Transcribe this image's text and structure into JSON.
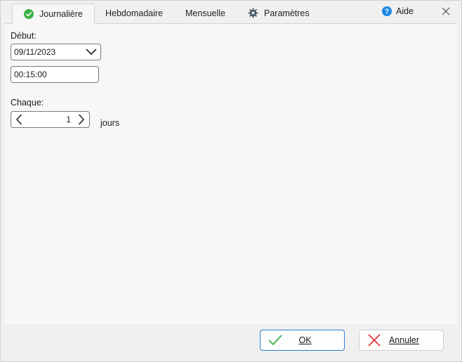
{
  "tabs": [
    {
      "label": "Journalière",
      "icon": "check-circle-icon",
      "active": true
    },
    {
      "label": "Hebdomadaire",
      "active": false
    },
    {
      "label": "Mensuelle",
      "active": false
    },
    {
      "label": "Paramètres",
      "icon": "gear-icon",
      "active": false
    }
  ],
  "help": {
    "label": "Aide",
    "icon": "help-icon"
  },
  "form": {
    "start_label": "Début:",
    "start_date": "09/11/2023",
    "start_time": "00:15:00",
    "every_label": "Chaque:",
    "every_value": "1",
    "every_unit": "jours"
  },
  "buttons": {
    "ok": {
      "label": "OK",
      "icon": "check-icon"
    },
    "cancel": {
      "label": "Annuler",
      "icon": "cross-icon"
    }
  },
  "colors": {
    "accent": "#2e7bd6",
    "success": "#3cb043",
    "cancel": "#e0393e",
    "help": "#1e88e5"
  }
}
